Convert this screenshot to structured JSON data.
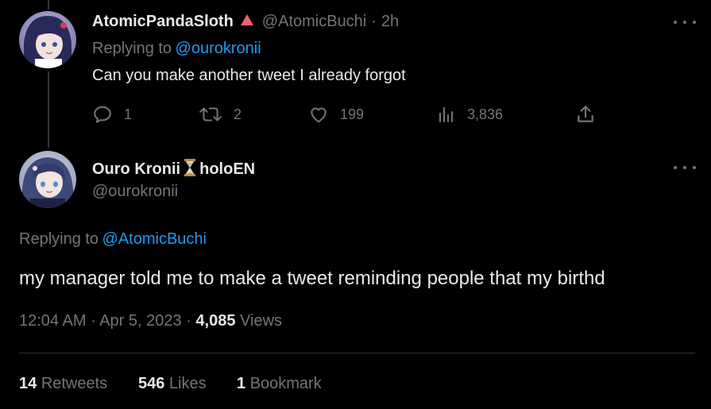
{
  "reply_tweet": {
    "display_name": "AtomicPandaSloth",
    "badge": "🔺",
    "handle": "@AtomicBuchi",
    "separator": "·",
    "time": "2h",
    "replying_prefix": "Replying to",
    "replying_to": "@ourokronii",
    "text": "Can you make another tweet I already forgot",
    "actions": {
      "replies": "1",
      "retweets": "2",
      "likes": "199",
      "views": "3,836"
    }
  },
  "main_tweet": {
    "display_name": "Ouro Kronii",
    "badge": "⏳",
    "name_suffix": "holoEN",
    "handle": "@ourokronii",
    "replying_prefix": "Replying to",
    "replying_to": "@AtomicBuchi",
    "text": "my manager told me to make a tweet reminding people that my birthd",
    "time": "12:04 AM",
    "date": "Apr 5, 2023",
    "sep": "·",
    "views_count": "4,085",
    "views_label": "Views",
    "stats": {
      "retweets_count": "14",
      "retweets_label": "Retweets",
      "likes_count": "546",
      "likes_label": "Likes",
      "bookmarks_count": "1",
      "bookmarks_label": "Bookmark"
    }
  },
  "colors": {
    "background": "#000000",
    "text": "#e7e9ea",
    "muted": "#71767b",
    "link": "#1d9bf0",
    "divider": "#2f3336"
  },
  "icons": [
    "more-icon",
    "reply-icon",
    "retweet-icon",
    "like-icon",
    "views-icon",
    "share-icon",
    "hourglass-icon",
    "red-triangle-icon"
  ]
}
